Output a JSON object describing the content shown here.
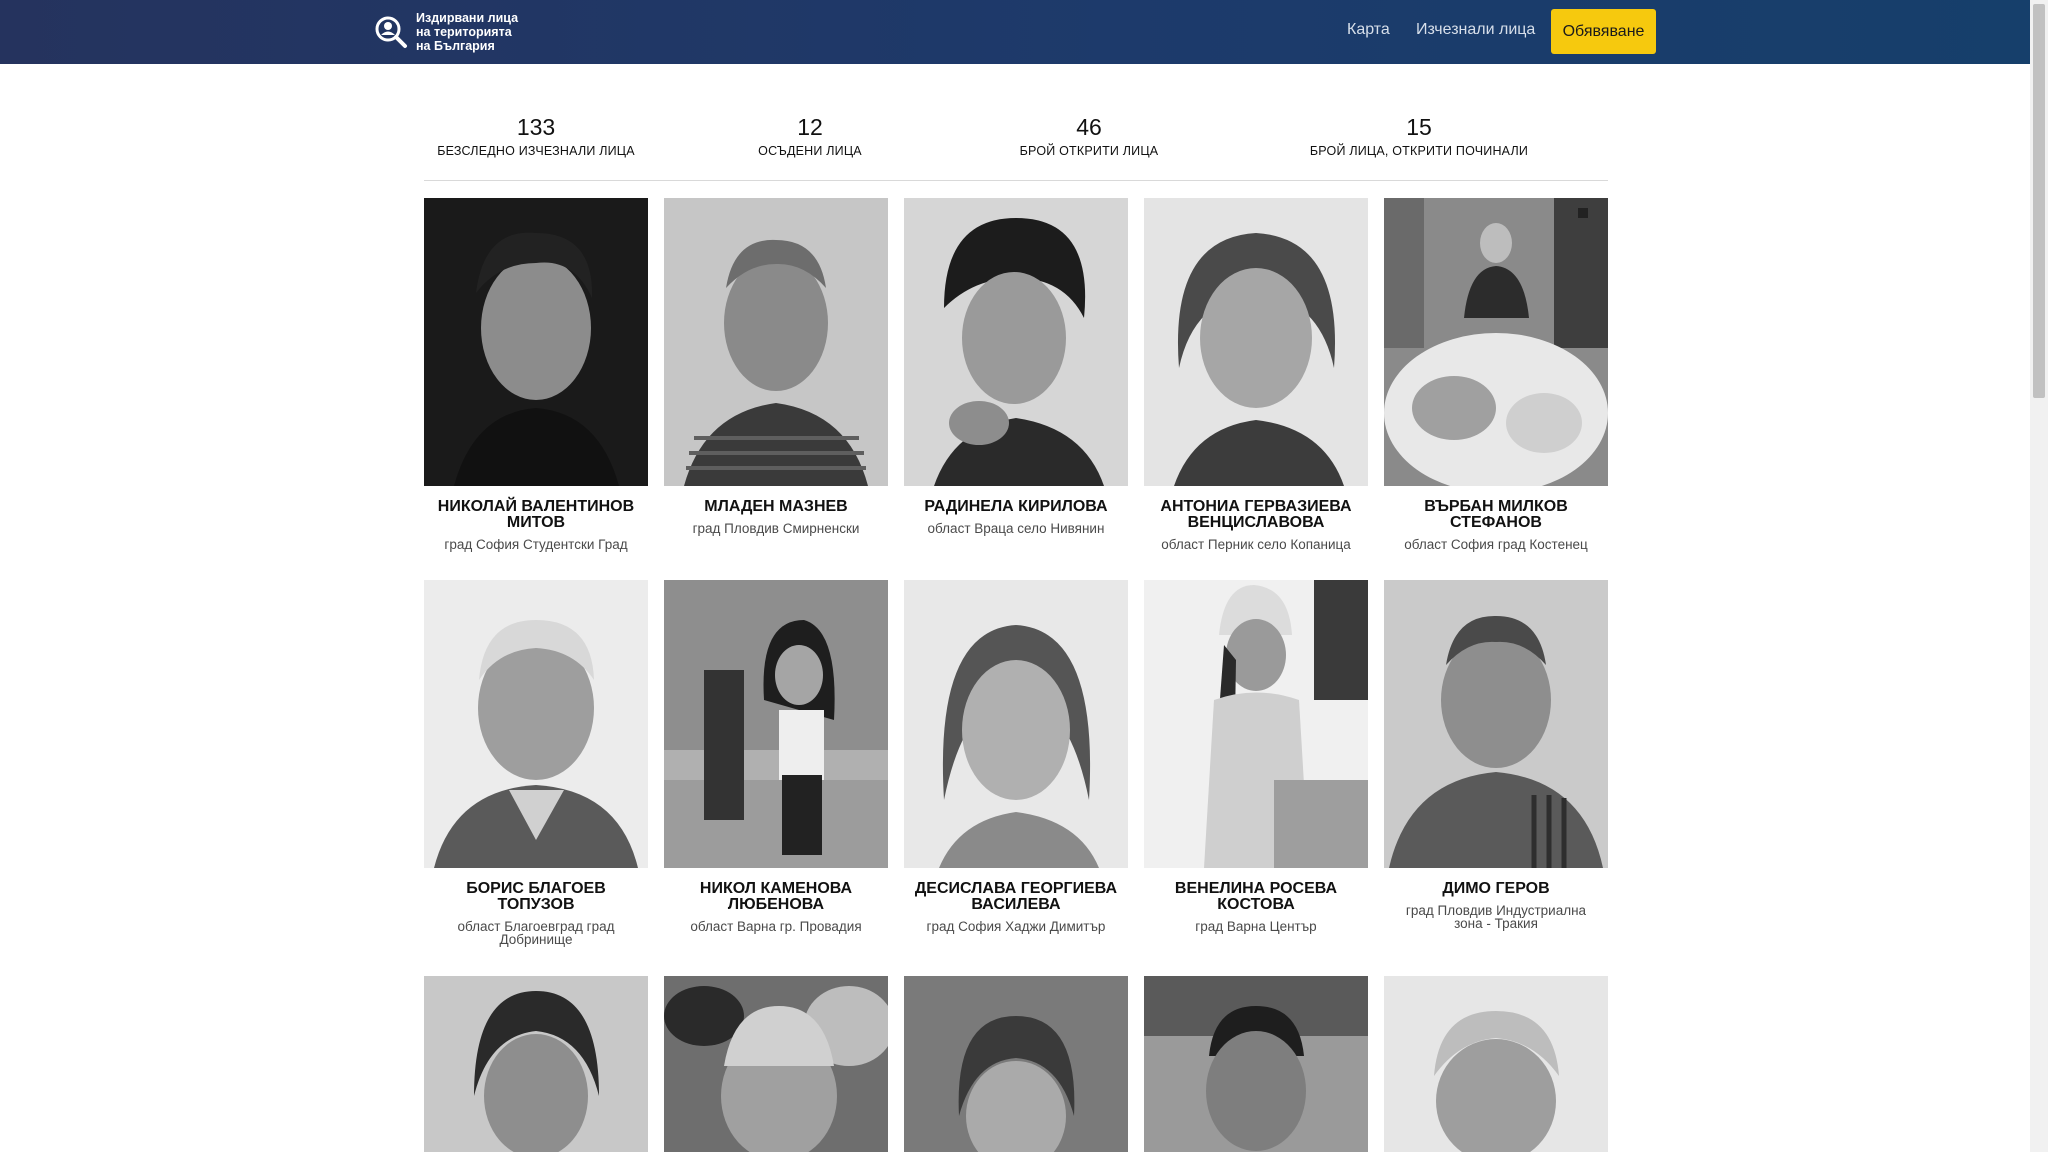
{
  "header": {
    "brand_line1": "Издирвани лица",
    "brand_line2": "на територията",
    "brand_line3": "на България",
    "nav_map": "Карта",
    "nav_missing": "Изчезнали лица",
    "nav_announce": "Обявяване"
  },
  "stats": [
    {
      "number": "133",
      "label": "БЕЗСЛЕДНО ИЗЧЕЗНАЛИ ЛИЦА"
    },
    {
      "number": "12",
      "label": "ОСЪДЕНИ ЛИЦА"
    },
    {
      "number": "46",
      "label": "БРОЙ ОТКРИТИ ЛИЦА"
    },
    {
      "number": "15",
      "label": "БРОЙ ЛИЦА, ОТКРИТИ ПОЧИНАЛИ"
    }
  ],
  "people": [
    {
      "name": "НИКОЛАЙ ВАЛЕНТИНОВ МИТОВ",
      "place": "град София Студентски Град"
    },
    {
      "name": "МЛАДЕН МАЗНЕВ",
      "place": "град Пловдив Смирненски"
    },
    {
      "name": "РАДИНЕЛА КИРИЛОВА",
      "place": "област Враца село Нивянин"
    },
    {
      "name": "АНТОНИА ГЕРВАЗИЕВА ВЕНЦИСЛАВОВА",
      "place": "област Перник село Копаница"
    },
    {
      "name": "ВЪРБАН МИЛКОВ СТЕФАНОВ",
      "place": "област София град Костенец"
    },
    {
      "name": "БОРИС БЛАГОЕВ ТОПУЗОВ",
      "place": "област Благоевград град Добринище"
    },
    {
      "name": "НИКОЛ КАМЕНОВА ЛЮБЕНОВА",
      "place": "област Варна гр. Провадия"
    },
    {
      "name": "ДЕСИСЛАВА ГЕОРГИЕВА ВАСИЛЕВА",
      "place": "град София Хаджи Димитър"
    },
    {
      "name": "ВЕНЕЛИНА РОСЕВА КОСТОВА",
      "place": "град Варна Център"
    },
    {
      "name": "ДИМО ГЕРОВ",
      "place": "град Пловдив Индустриална зона - Тракия"
    }
  ]
}
